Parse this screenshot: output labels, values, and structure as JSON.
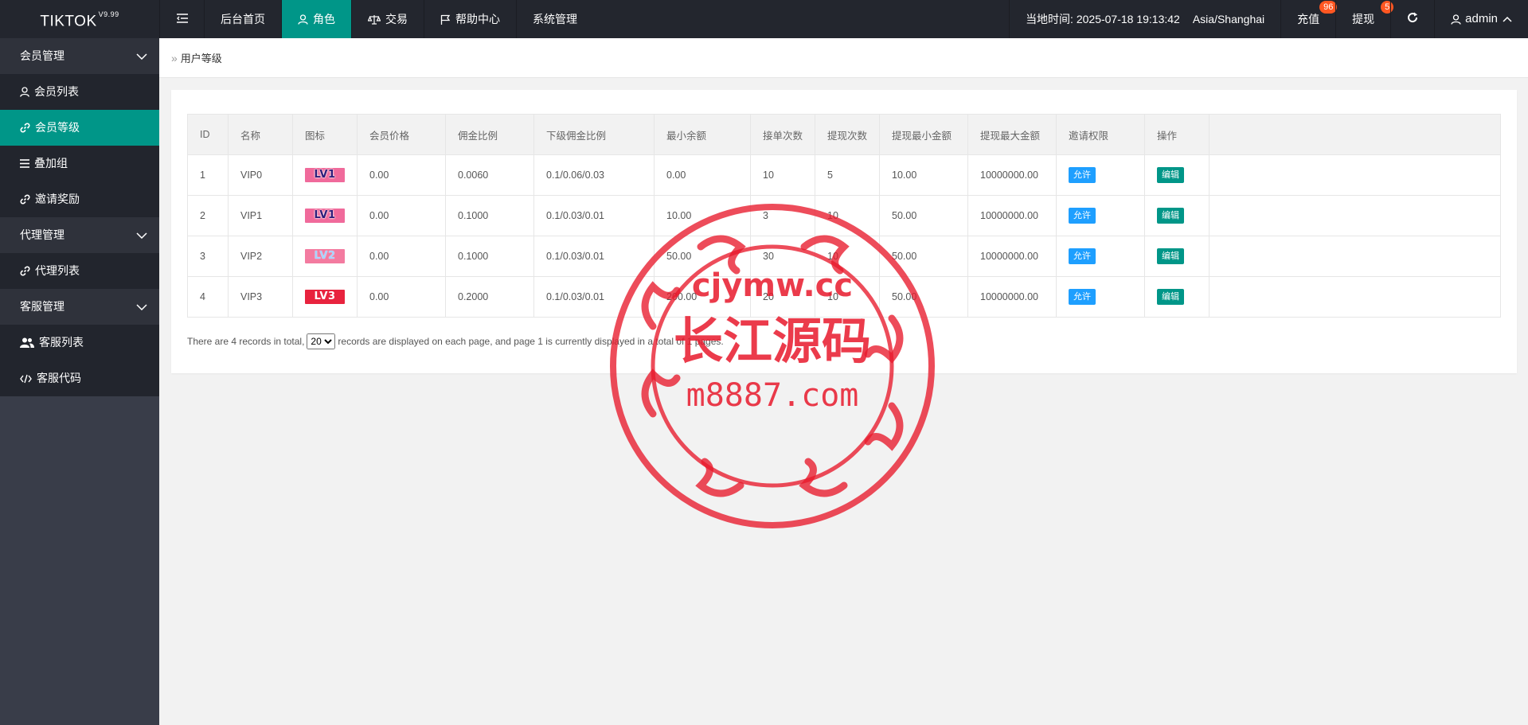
{
  "header": {
    "logo": "TIKTOK",
    "version": "V9.99",
    "nav": [
      {
        "label": "后台首页"
      },
      {
        "label": "角色"
      },
      {
        "label": "交易"
      },
      {
        "label": "帮助中心"
      },
      {
        "label": "系统管理"
      }
    ],
    "time_label": "当地时间: 2025-07-18 19:13:42",
    "timezone": "Asia/Shanghai",
    "recharge_label": "充值",
    "recharge_badge": "96",
    "withdraw_label": "提现",
    "withdraw_badge": "5",
    "user": "admin"
  },
  "sidebar": {
    "groups": [
      {
        "label": "会员管理",
        "items": [
          {
            "label": "会员列表"
          },
          {
            "label": "会员等级"
          },
          {
            "label": "叠加组"
          },
          {
            "label": "邀请奖励"
          }
        ]
      },
      {
        "label": "代理管理",
        "items": [
          {
            "label": "代理列表"
          }
        ]
      },
      {
        "label": "客服管理",
        "items": [
          {
            "label": "客服列表"
          },
          {
            "label": "客服代码"
          }
        ]
      }
    ]
  },
  "breadcrumb": "用户等级",
  "table": {
    "headers": [
      "ID",
      "名称",
      "图标",
      "会员价格",
      "佣金比例",
      "下级佣金比例",
      "最小余额",
      "接单次数",
      "提现次数",
      "提现最小金额",
      "提现最大金额",
      "邀请权限",
      "操作"
    ],
    "rows": [
      {
        "id": "1",
        "name": "VIP0",
        "icon": "LV1",
        "price": "0.00",
        "commission": "0.0060",
        "sub_commission": "0.1/0.06/0.03",
        "min_balance": "0.00",
        "orders": "10",
        "withdraw_times": "5",
        "withdraw_min": "10.00",
        "withdraw_max": "10000000.00",
        "invite": "允许",
        "action": "编辑"
      },
      {
        "id": "2",
        "name": "VIP1",
        "icon": "LV1",
        "price": "0.00",
        "commission": "0.1000",
        "sub_commission": "0.1/0.03/0.01",
        "min_balance": "10.00",
        "orders": "3",
        "withdraw_times": "10",
        "withdraw_min": "50.00",
        "withdraw_max": "10000000.00",
        "invite": "允许",
        "action": "编辑"
      },
      {
        "id": "3",
        "name": "VIP2",
        "icon": "LV2",
        "price": "0.00",
        "commission": "0.1000",
        "sub_commission": "0.1/0.03/0.01",
        "min_balance": "50.00",
        "orders": "30",
        "withdraw_times": "10",
        "withdraw_min": "50.00",
        "withdraw_max": "10000000.00",
        "invite": "允许",
        "action": "编辑"
      },
      {
        "id": "4",
        "name": "VIP3",
        "icon": "LV3",
        "price": "0.00",
        "commission": "0.2000",
        "sub_commission": "0.1/0.03/0.01",
        "min_balance": "200.00",
        "orders": "20",
        "withdraw_times": "10",
        "withdraw_min": "50.00",
        "withdraw_max": "10000000.00",
        "invite": "允许",
        "action": "编辑"
      }
    ]
  },
  "pager": {
    "before": "There are 4 records in total,",
    "page_size": "20",
    "after": "records are displayed on each page, and page 1 is currently displayed in a total of 1 pages."
  },
  "watermark": {
    "line1": "cjymw.cc",
    "line2": "长江源码",
    "line3": "m8887.com"
  },
  "colors": {
    "header_bg": "#23262e",
    "sidebar_bg": "#393d49",
    "accent": "#009688",
    "blue": "#1e9fff",
    "badge": "#ff5722",
    "seal": "#e8192c"
  }
}
